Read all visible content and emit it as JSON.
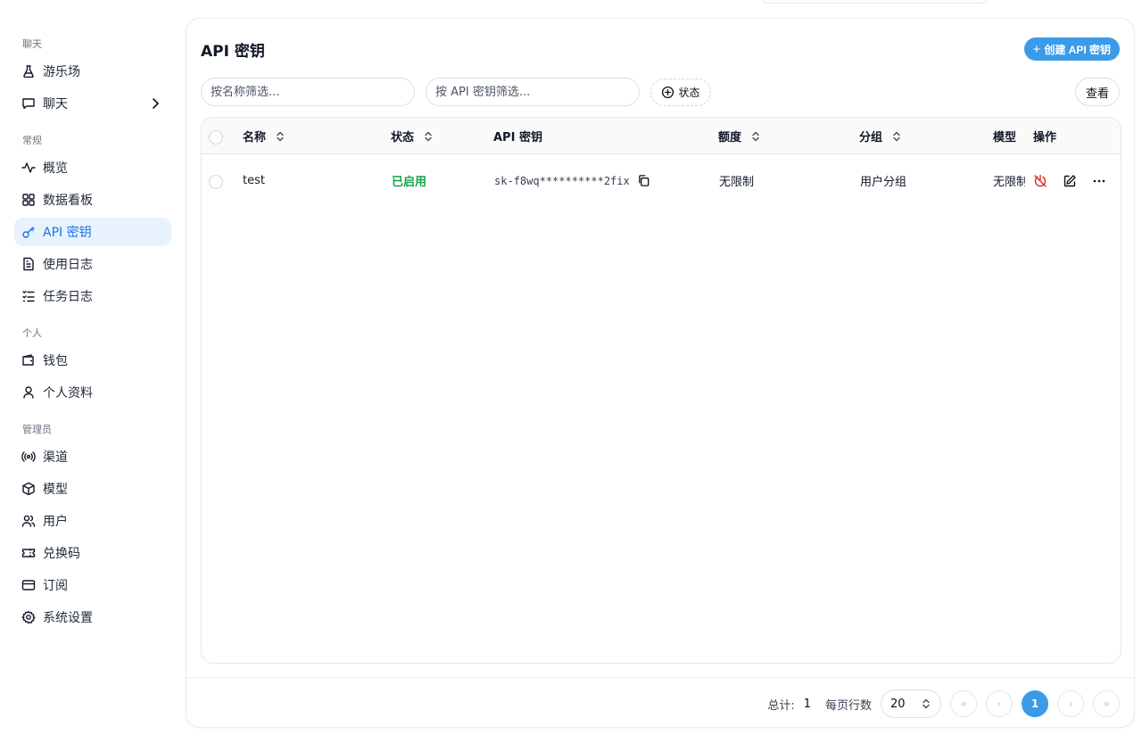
{
  "sidebar": {
    "sections": [
      {
        "label": "聊天",
        "items": [
          {
            "label": "游乐场",
            "icon": "flask-icon"
          },
          {
            "label": "聊天",
            "icon": "chat-bubble-icon",
            "has_chevron": true
          }
        ]
      },
      {
        "label": "常规",
        "items": [
          {
            "label": "概览",
            "icon": "activity-icon"
          },
          {
            "label": "数据看板",
            "icon": "dashboard-icon"
          },
          {
            "label": "API 密钥",
            "icon": "key-icon",
            "active": true
          },
          {
            "label": "使用日志",
            "icon": "document-icon"
          },
          {
            "label": "任务日志",
            "icon": "checklist-icon"
          }
        ]
      },
      {
        "label": "个人",
        "items": [
          {
            "label": "钱包",
            "icon": "wallet-icon"
          },
          {
            "label": "个人资料",
            "icon": "user-icon"
          }
        ]
      },
      {
        "label": "管理员",
        "items": [
          {
            "label": "渠道",
            "icon": "radio-icon"
          },
          {
            "label": "模型",
            "icon": "cube-icon"
          },
          {
            "label": "用户",
            "icon": "users-icon"
          },
          {
            "label": "兑换码",
            "icon": "ticket-icon"
          },
          {
            "label": "订阅",
            "icon": "card-icon"
          },
          {
            "label": "系统设置",
            "icon": "gear-icon"
          }
        ]
      }
    ]
  },
  "main": {
    "title": "API 密钥",
    "create_button": "创建 API 密钥",
    "filters": {
      "name_placeholder": "按名称筛选...",
      "key_placeholder": "按 API 密钥筛选...",
      "status_label": "状态",
      "view_label": "查看"
    },
    "table": {
      "columns": [
        "名称",
        "状态",
        "API 密钥",
        "额度",
        "分组",
        "模型",
        "操作"
      ],
      "rows": [
        {
          "name": "test",
          "status": "已启用",
          "key": "sk-f8wq**********2fix",
          "quota": "无限制",
          "group": "用户分组",
          "model": "无限制"
        }
      ]
    },
    "footer": {
      "total_label": "总计:",
      "total_value": "1",
      "page_size_label": "每页行数",
      "page_size": "20",
      "current_page": "1"
    }
  },
  "colors": {
    "accent": "#3b9be8",
    "active_bg": "#e8f2fd",
    "active_text": "#1a73e8",
    "status_enabled": "#16a34a",
    "danger": "#dc2626"
  }
}
